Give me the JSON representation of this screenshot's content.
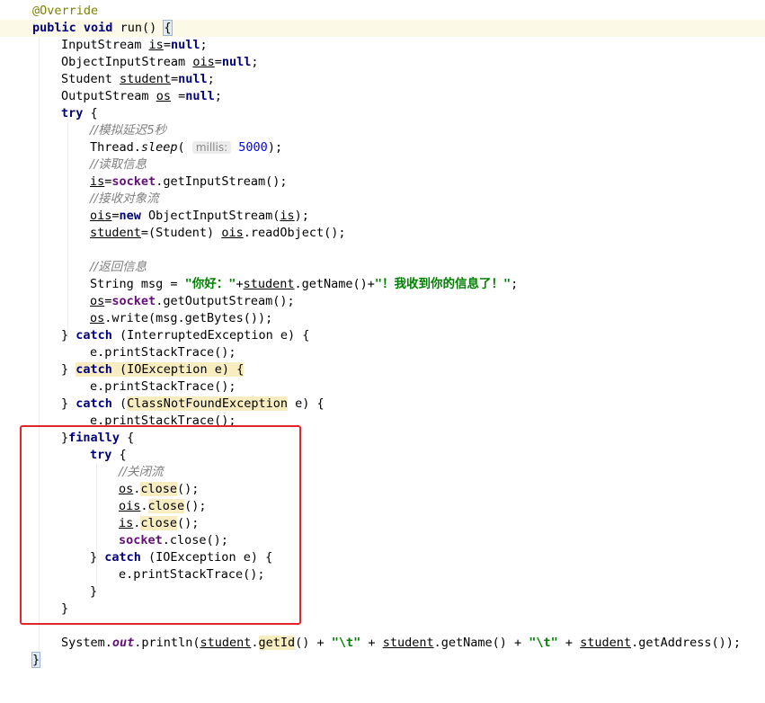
{
  "editor": {
    "language": "java",
    "colors": {
      "keyword": "#000080",
      "comment": "#808080",
      "string": "#008000",
      "number": "#0000ff",
      "field": "#660e7a",
      "annotation": "#808000",
      "highlight_box": "#e1262a"
    },
    "code": {
      "l1": "@Override",
      "l2_kw1": "public",
      "l2_kw2": "void",
      "l2_name": "run()",
      "l2_brace": "{",
      "l3_type": "InputStream",
      "l3_var": "is",
      "l3_eq": "=",
      "l3_null": "null",
      "l3_semi": ";",
      "l4_type": "ObjectInputStream",
      "l4_var": "ois",
      "l4_eq": "=",
      "l4_null": "null",
      "l4_semi": ";",
      "l5_type": "Student",
      "l5_var": "student",
      "l5_eq": "=",
      "l5_null": "null",
      "l5_semi": ";",
      "l6_type": "OutputStream",
      "l6_var": "os",
      "l6_eq": " =",
      "l6_null": "null",
      "l6_semi": ";",
      "l7_kw": "try",
      "l7_brace": " {",
      "l8_comment": "//模拟延迟5秒",
      "l9_a": "Thread.",
      "l9_b": "sleep",
      "l9_c": "(",
      "l9_hint": "millis:",
      "l9_num": "5000",
      "l9_d": ");",
      "l10_comment": "//读取信息",
      "l11_var": "is",
      "l11_eq": "=",
      "l11_fld": "socket",
      "l11_rest": ".getInputStream();",
      "l12_comment": "//接收对象流",
      "l13_var": "ois",
      "l13_eq": "=",
      "l13_new": "new",
      "l13_a": " ObjectInputStream(",
      "l13_arg": "is",
      "l13_b": ");",
      "l14_var": "student",
      "l14_a": "=(Student) ",
      "l14_arg": "ois",
      "l14_b": ".readObject();",
      "l16_comment": "//返回信息",
      "l17_a": "String msg = ",
      "l17_s1": "\"你好：\"",
      "l17_b": "+",
      "l17_var": "student",
      "l17_c": ".getName()+",
      "l17_s2": "\"！我收到你的信息了！\"",
      "l17_d": ";",
      "l18_var": "os",
      "l18_eq": "=",
      "l18_fld": "socket",
      "l18_rest": ".getOutputStream();",
      "l19_var": "os",
      "l19_rest": ".write(msg.getBytes());",
      "l20_a": "} ",
      "l20_kw": "catch",
      "l20_b": " (InterruptedException e) {",
      "l21": "e.printStackTrace();",
      "l22_a": "} ",
      "l22_kw": "catch",
      "l22_b": " (IOException e) {",
      "l23": "e.printStackTrace();",
      "l24_a": "} ",
      "l24_kw": "catch",
      "l24_b": " (",
      "l24_exc": "ClassNotFoundException",
      "l24_c": " e) {",
      "l25": "e.printStackTrace();",
      "l26_a": "}",
      "l26_kw": "finally",
      "l26_b": " {",
      "l27_kw": "try",
      "l27_b": " {",
      "l28_comment": "//关闭流",
      "l29_var": "os",
      "l29_dot": ".",
      "l29_m": "close",
      "l29_end": "();",
      "l30_var": "ois",
      "l30_dot": ".",
      "l30_m": "close",
      "l30_end": "();",
      "l31_var": "is",
      "l31_dot": ".",
      "l31_m": "close",
      "l31_end": "();",
      "l32_fld": "socket",
      "l32_rest": ".close();",
      "l33_a": "} ",
      "l33_kw": "catch",
      "l33_b": " (IOException e) {",
      "l34": "e.printStackTrace();",
      "l35": "}",
      "l36": "}",
      "l38_a": "System.",
      "l38_out": "out",
      "l38_b": ".println(",
      "l38_v1": "student",
      "l38_dot1": ".",
      "l38_m1": "getId",
      "l38_c": "() + ",
      "l38_s1": "\"\\t\"",
      "l38_d": " + ",
      "l38_v2": "student",
      "l38_e": ".getName() + ",
      "l38_s2": "\"\\t\"",
      "l38_f": " + ",
      "l38_v3": "student",
      "l38_g": ".getAddress());",
      "l39": "}"
    }
  }
}
